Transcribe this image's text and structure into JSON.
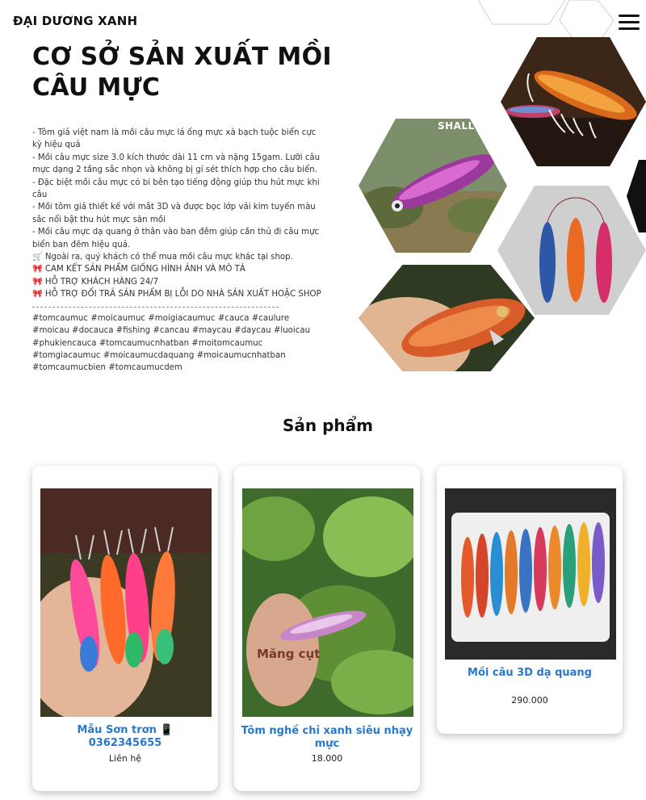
{
  "header": {
    "brand": "ĐẠI DƯƠNG XANH",
    "menu_icon": "hamburger-menu-icon"
  },
  "hero": {
    "title": "CƠ SỞ SẢN XUẤT MỒI CÂU MỰC",
    "lines": [
      "- Tôm giả việt nam là mồi câu mực lá ống mực xà bạch tuộc biển cực kỳ hiệu quả",
      "- Mồi câu mực size 3.0 kích thước dài 11 cm và nặng 15gam. Lưỡi câu mực dạng 2 tầng sắc nhọn và không bị gỉ sét thích hợp cho câu biển.",
      "- Đặc biệt mồi câu mực có bi bên tạo tiếng động giúp thu hút mực khi câu",
      "- Mồi tôm giả thiết kế với mắt 3D và được bọc lớp vải kim tuyến màu sắc nổi bật thu hút mực săn mồi",
      "- Mồi câu mực dạ quang ở thân vào ban đêm giúp cần thủ đi câu mực biển ban đêm hiệu quả.",
      "🛒 Ngoài ra, quý khách có thể mua mồi câu mực khác tại shop.",
      "🎀 CAM KẾT SẢN PHẨM GIỐNG HÌNH ẢNH VÀ MÔ TẢ",
      "🎀 HỖ TRỢ KHÁCH HÀNG 24/7",
      "🎀 HỖ TRỢ ĐỔI TRẢ SẢN PHẨM BỊ LỖI DO NHÀ SẢN XUẤT HOẶC SHOP"
    ],
    "hashtags": "#tomcaumuc #moicaumuc #moigiacaumuc #cauca #caulure #moicau #docauca #fishing #cancau #maycau #daycau #luoicau #phukiencauca #tomcaumucnhatban #moitomcaumuc #tomgiacaumuc #moicaumucdaquang #moicaumucnhatban #tomcaumucbien #tomcaumucdem",
    "hex_label": "SHALLOW"
  },
  "products": {
    "title": "Sản phẩm",
    "items": [
      {
        "name": "Mẫu Sơn trơn 📱 0362345655",
        "price": "Liên hệ"
      },
      {
        "name": "Tôm nghề chỉ xanh siêu nhạy mực",
        "price": "18.000",
        "overlay": "Măng cụt"
      },
      {
        "name": "Mồi câu 3D dạ quang",
        "price": "290.000"
      }
    ]
  },
  "colors": {
    "accent": "#2a79c9",
    "text": "#222222"
  }
}
